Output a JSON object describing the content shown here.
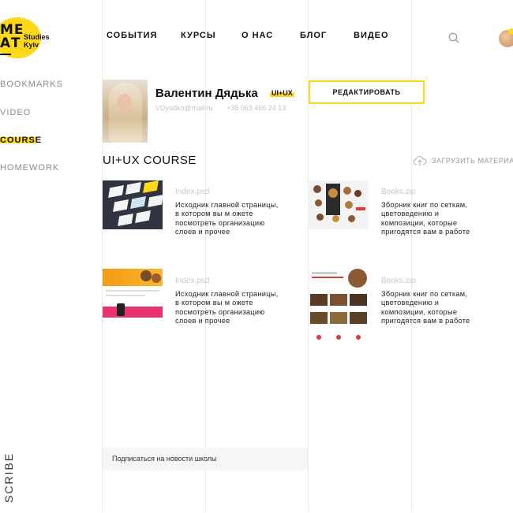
{
  "logo": {
    "line1": "ME",
    "line2": "AT",
    "studio": "Studies",
    "city": "Kyiv"
  },
  "nav": [
    "СОБЫТИЯ",
    "КУРСЫ",
    "О НАС",
    "БЛОГ",
    "ВИДЕО"
  ],
  "icons": {
    "search": "search-icon",
    "avatar": "user-avatar",
    "upload": "cloud-upload-icon"
  },
  "sidebar": {
    "items": [
      {
        "label": "BOOKMARKS"
      },
      {
        "label": "VIDEO"
      },
      {
        "label": "COURSE"
      },
      {
        "label": "HOMEWORK"
      }
    ],
    "subscribe": "SCRIBE"
  },
  "profile": {
    "name": "Валентин Дядька",
    "badge": "UI+UX",
    "email": "VDyadko@mail.ru",
    "phone": "+38 063 466 24 13",
    "edit_label": "РЕДАКТИРОВАТЬ"
  },
  "course": {
    "title": "UI+UX COURSE",
    "upload_label": "ЗАГРУЗИТЬ МАТЕРИАЛ"
  },
  "materials": [
    {
      "file": "Index.psd",
      "desc": "Исходник главной страницы, в котором вы м ожете посмотреть организацию слоев и прочее"
    },
    {
      "file": "Books.zip",
      "desc": "Зборник книг по сеткам, цветоведению и композиции, которые пригодятся вам в работе"
    },
    {
      "file": "Index.psd",
      "desc": "Исходник главной страницы, в котором вы м ожете посмотреть организацию слоев и прочее"
    },
    {
      "file": "Books.zip",
      "desc": "Зборник книг по сеткам, цветоведению и композиции, которые пригодятся вам в работе"
    }
  ],
  "newsletter": {
    "label": "Подписаться на новости школы"
  },
  "colors": {
    "accent": "#ffd81a",
    "muted": "#8a8a8a",
    "bg_light": "#f6f6f6"
  }
}
